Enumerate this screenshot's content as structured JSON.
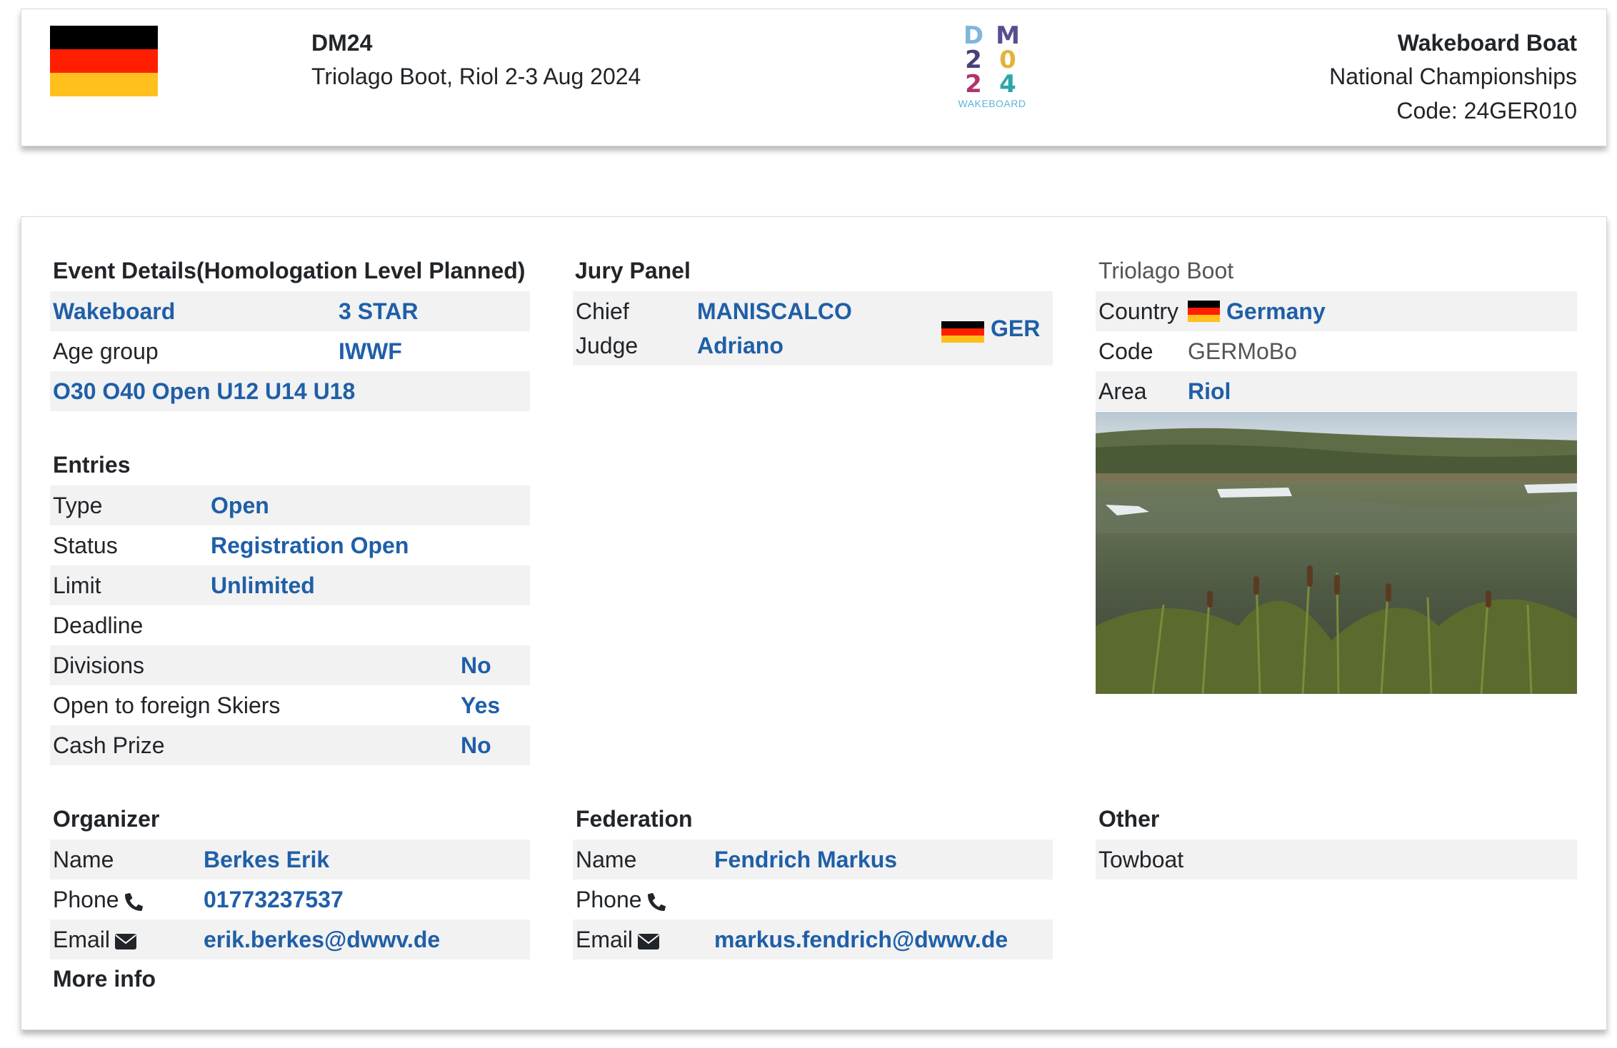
{
  "header": {
    "event_code": "DM24",
    "location_dates": "Triolago Boot, Riol 2-3 Aug 2024",
    "discipline": "Wakeboard Boat",
    "championship": "National Championships",
    "code": "Code: 24GER010",
    "logo": {
      "letters": [
        "D",
        "M",
        "2",
        "0",
        "2",
        "4"
      ],
      "subtitle": "WAKEBOARD"
    },
    "flag_colors": [
      "#000000",
      "#ff1f00",
      "#ffc01e"
    ]
  },
  "event_details": {
    "title": "Event Details(Homologation Level Planned)",
    "discipline": "Wakeboard",
    "level": "3 STAR",
    "age_group_label": "Age group",
    "age_group_value": "IWWF",
    "categories": "O30 O40 Open U12 U14 U18"
  },
  "entries": {
    "title": "Entries",
    "rows": [
      {
        "label": "Type",
        "value": "Open"
      },
      {
        "label": "Status",
        "value": "Registration Open"
      },
      {
        "label": "Limit",
        "value": "Unlimited"
      },
      {
        "label": "Deadline",
        "value": ""
      },
      {
        "label": "Divisions",
        "value": "No"
      },
      {
        "label": "Open to foreign Skiers",
        "value": "Yes"
      },
      {
        "label": "Cash Prize",
        "value": "No"
      }
    ]
  },
  "jury": {
    "title": "Jury Panel",
    "role_line1": "Chief",
    "role_line2": "Judge",
    "surname": "MANISCALCO",
    "firstname": "Adriano",
    "country": "GER"
  },
  "site": {
    "title": "Triolago Boot",
    "country_label": "Country",
    "country_value": "Germany",
    "code_label": "Code",
    "code_value": "GERMoBo",
    "area_label": "Area",
    "area_value": "Riol"
  },
  "organizer": {
    "title": "Organizer",
    "name_label": "Name",
    "name_value": "Berkes Erik",
    "phone_label": "Phone",
    "phone_value": "01773237537",
    "email_label": "Email",
    "email_value": "erik.berkes@dwwv.de",
    "more_info": "More info"
  },
  "federation": {
    "title": "Federation",
    "name_label": "Name",
    "name_value": "Fendrich Markus",
    "phone_label": "Phone",
    "phone_value": "",
    "email_label": "Email",
    "email_value": "markus.fendrich@dwwv.de"
  },
  "other": {
    "title": "Other",
    "item": "Towboat"
  },
  "colors": {
    "link": "#1f5fa8",
    "row_shade": "#f2f2f2"
  }
}
